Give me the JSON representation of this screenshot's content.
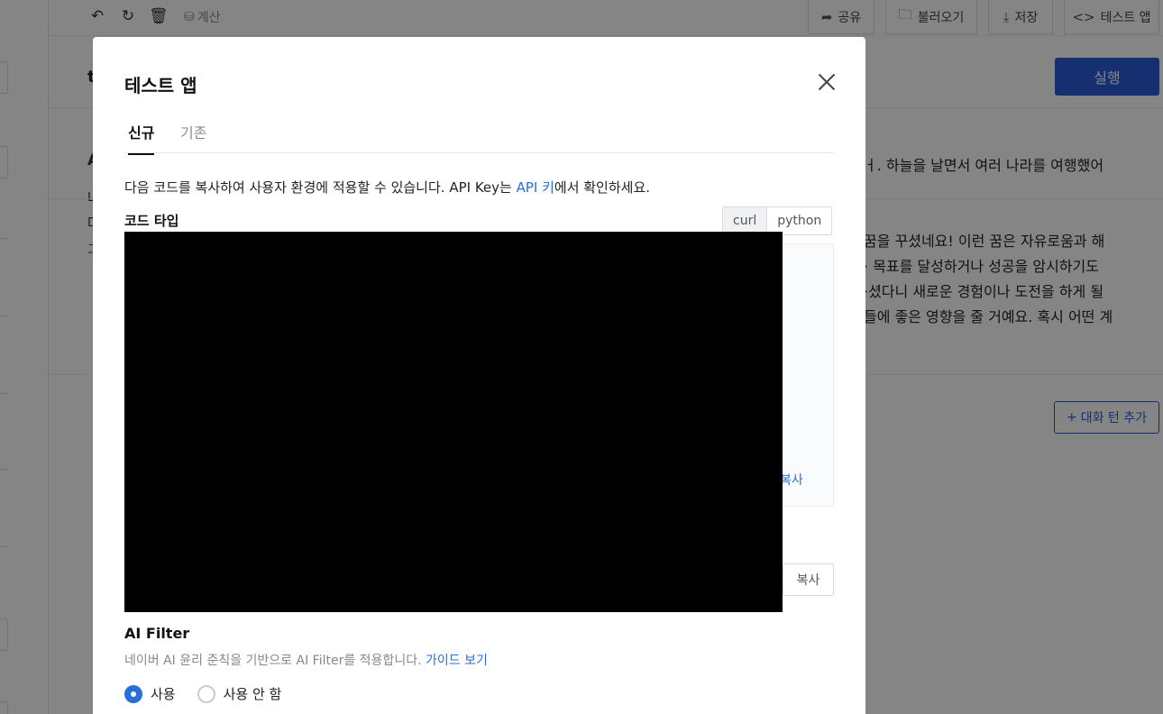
{
  "toolbar": {
    "undo_icon": "undo-icon",
    "refresh_icon": "refresh-icon",
    "trash_icon": "trash-icon",
    "calc_label": "계산",
    "share_label": "공유",
    "load_label": "불러오기",
    "save_label": "저장",
    "test_app_label": "테스트 앱"
  },
  "background": {
    "title_initial": "t",
    "run_label": "실행",
    "chat_line_1": "ㅓ. 하늘을 날면서 여러 나라를 여행했어",
    "reply_lines": [
      "꿈을 꾸셨네요! 이런 꿈은 자유로움과 해",
      "· 목표를 달성하거나 성공을 암시하기도",
      "·셨다니 새로운 경험이나 도전을 하게 될",
      "들에 좋은 영향을 줄 거예요. 혹시 어떤 계"
    ],
    "left_fragments": [
      "A",
      "L",
      "D",
      "그"
    ],
    "add_turn_label": "대화 턴 추가"
  },
  "modal": {
    "title": "테스트 앱",
    "tabs": [
      {
        "label": "신규",
        "active": true
      },
      {
        "label": "기존",
        "active": false
      }
    ],
    "intro_prefix": "다음 코드를 복사하여 사용자 환경에 적용할 수 있습니다. API Key는 ",
    "intro_link": "API 키",
    "intro_suffix": "에서 확인하세요.",
    "code_type_label": "코드 타입",
    "code_types": [
      {
        "label": "curl",
        "active": true
      },
      {
        "label": "python",
        "active": false
      }
    ],
    "code_copy_label": "복사",
    "copy_button_label": "복사",
    "ai_filter": {
      "title": "AI Filter",
      "desc_prefix": "네이버 AI 윤리 준칙을 기반으로 AI Filter를 적용합니다. ",
      "guide_link": "가이드 보기",
      "options": [
        {
          "label": "사용",
          "selected": true
        },
        {
          "label": "사용 안 함",
          "selected": false
        }
      ]
    }
  },
  "colors": {
    "accent": "#2a5bd7",
    "link": "#2a6fd6"
  }
}
